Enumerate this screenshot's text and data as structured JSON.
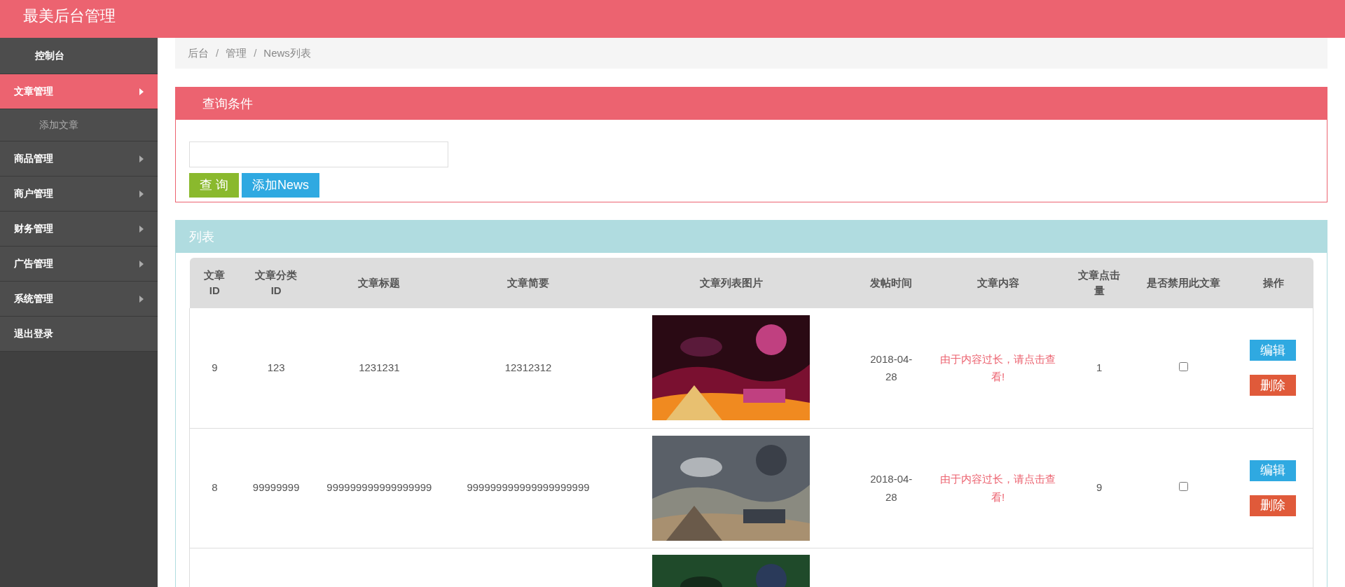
{
  "header": {
    "title": "最美后台管理"
  },
  "sidebar": {
    "items": [
      {
        "label": "控制台",
        "kind": "top",
        "selected": false
      },
      {
        "label": "文章管理",
        "kind": "menu",
        "selected": true,
        "children": [
          {
            "label": "添加文章",
            "kind": "sub",
            "selected": false
          }
        ]
      },
      {
        "label": "商品管理",
        "kind": "menu",
        "selected": false
      },
      {
        "label": "商户管理",
        "kind": "menu",
        "selected": false
      },
      {
        "label": "财务管理",
        "kind": "menu",
        "selected": false
      },
      {
        "label": "广告管理",
        "kind": "menu",
        "selected": false
      },
      {
        "label": "系统管理",
        "kind": "menu",
        "selected": false
      },
      {
        "label": "退出登录",
        "kind": "link",
        "selected": false
      }
    ]
  },
  "breadcrumb": {
    "items": [
      "后台",
      "管理",
      "News列表"
    ],
    "separator": "/"
  },
  "query_panel": {
    "title": "查询条件",
    "buttons": [
      {
        "label": "查 询",
        "kind": "search"
      },
      {
        "label": "添加News",
        "kind": "add"
      }
    ]
  },
  "list_panel": {
    "title": "列表",
    "table": {
      "columns": [
        "文章ID",
        "文章分类ID",
        "文章标题",
        "文章简要",
        "文章列表图片",
        "发帖时间",
        "文章内容",
        "文章点击量",
        "是否禁用此文章",
        "操作"
      ],
      "rows": [
        {
          "id": "9",
          "category_id": "123",
          "title": "1231231",
          "summary": "12312312",
          "image": {
            "kind": "picture"
          },
          "time": "2018-04-28",
          "content": "由于内容过长，请点击查看!",
          "clicks": "1",
          "checked": false,
          "actions": [
            "编辑",
            "删除"
          ]
        },
        {
          "id": "8",
          "category_id": "99999999",
          "title": "999999999999999999",
          "summary": "999999999999999999999",
          "image": {
            "kind": "picture"
          },
          "time": "2018-04-28",
          "content": "由于内容过长，请点击查看!",
          "clicks": "9",
          "checked": false,
          "actions": [
            "编辑",
            "删除"
          ]
        },
        {
          "image": {
            "kind": "picture"
          }
        }
      ]
    }
  }
}
